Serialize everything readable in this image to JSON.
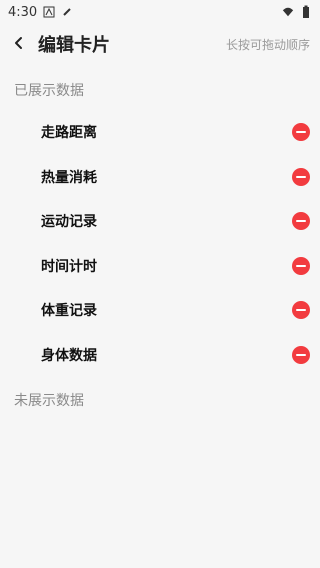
{
  "status_bar": {
    "time": "4:30"
  },
  "header": {
    "title": "编辑卡片",
    "hint": "长按可拖动顺序"
  },
  "sections": {
    "shown_title": "已展示数据",
    "hidden_title": "未展示数据"
  },
  "items": [
    {
      "label": "走路距离"
    },
    {
      "label": "热量消耗"
    },
    {
      "label": "运动记录"
    },
    {
      "label": "时间计时"
    },
    {
      "label": "体重记录"
    },
    {
      "label": "身体数据"
    }
  ],
  "colors": {
    "accent_remove": "#f23b3f",
    "background": "#f6f6f6"
  },
  "icons": [
    "back-arrow-icon",
    "remove-circle-icon",
    "wifi-icon",
    "battery-icon",
    "notification-a-icon",
    "pen-icon"
  ]
}
